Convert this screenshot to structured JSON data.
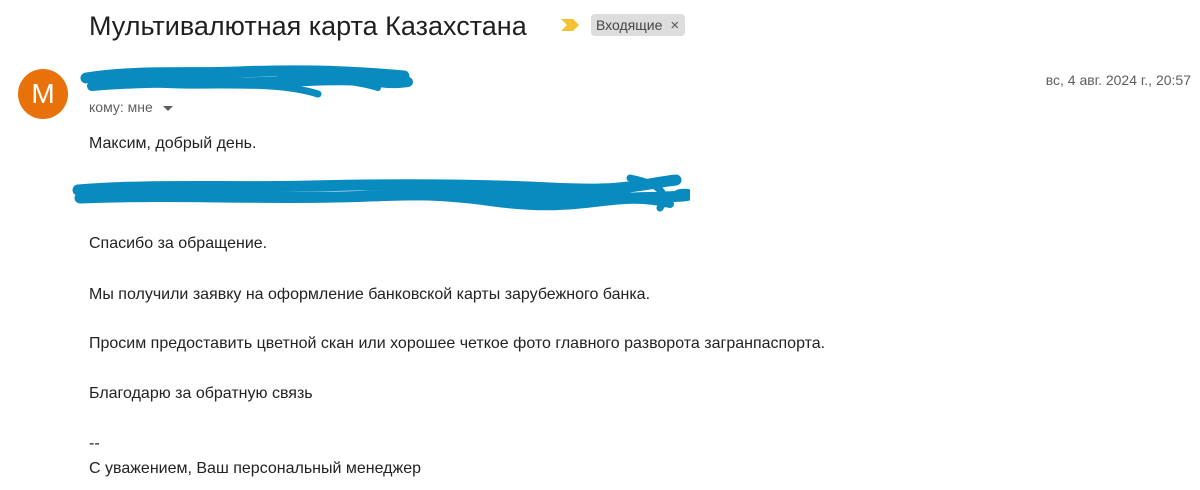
{
  "email": {
    "subject": "Мультивалютная карта Казахстана",
    "label": "Входящие",
    "label_close": "×",
    "sender_initial": "М",
    "date": "вс, 4 авг. 2024 г., 20:57",
    "recipient": "кому: мне",
    "greeting": "Максим,  добрый день.",
    "thanks": "Спасибо за обращение.",
    "request_received": "Мы получили заявку на оформление банковской карты зарубежного банка.",
    "request_scan": "Просим предоставить цветной скан или хорошее четкое фото главного разворота загранпаспорта.",
    "gratitude": "Благодарю за обратную связь",
    "signature_separator": "--",
    "signature": "С уважением, Ваш персональный менеджер"
  },
  "colors": {
    "avatar": "#e8710a",
    "redaction": "#0a8bbf",
    "important_marker": "#f2c230",
    "label_chip_bg": "#dddddd"
  },
  "icons": {
    "important": "importance-marker-icon",
    "dropdown": "caret-down-icon",
    "close": "close-icon"
  }
}
